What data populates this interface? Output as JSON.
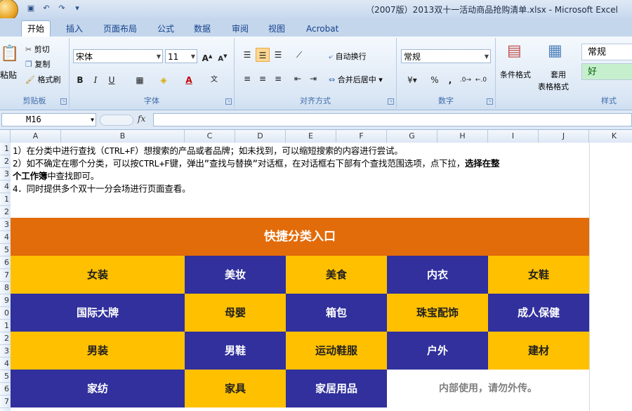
{
  "window": {
    "title": "（2007版）2013双十一活动商品抢购清单.xlsx - Microsoft Excel"
  },
  "ribbon": {
    "tabs": [
      "开始",
      "插入",
      "页面布局",
      "公式",
      "数据",
      "审阅",
      "视图",
      "Acrobat"
    ],
    "clipboard": {
      "paste": "粘贴",
      "cut": "剪切",
      "copy": "复制",
      "format_painter": "格式刷",
      "label": "剪贴板"
    },
    "font": {
      "name": "宋体",
      "size": "11",
      "label": "字体"
    },
    "alignment": {
      "wrap": "自动换行",
      "merge": "合并后居中",
      "label": "对齐方式"
    },
    "number": {
      "format": "常规",
      "label": "数字"
    },
    "styles": {
      "conditional": "条件格式",
      "table_format_line1": "套用",
      "table_format_line2": "表格格式",
      "normal": "常规",
      "good": "好",
      "label": "样式"
    }
  },
  "formula_bar": {
    "cell_ref": "M16",
    "fx": "fx",
    "value": ""
  },
  "columns": [
    "A",
    "B",
    "C",
    "D",
    "E",
    "F",
    "G",
    "H",
    "I",
    "J",
    "K"
  ],
  "rows": [
    "1",
    "2",
    "3",
    "4",
    "1",
    "2",
    "3",
    "4",
    "5",
    "6",
    "7",
    "8",
    "9",
    "0",
    "1",
    "2",
    "3",
    "4",
    "5",
    "6",
    "7"
  ],
  "notes": {
    "line1": "1）在分类中进行查找（CTRL+F）想搜索的产品或者品牌；如未找到，可以缩短搜索的内容进行尝试。",
    "line2_pre": "2）如不确定在哪个分类，可以按CTRL+F键，弹出”查找与替换”对话框，在对话框右下部有个查找范围选项，点下拉，",
    "line2_bold": "选择在整",
    "line3_bold": "个工作簿",
    "line3_post": "中查找即可。",
    "line4": "4．同时提供多个双十一分会场进行页面查看。"
  },
  "banner": "快捷分类入口",
  "categories": [
    [
      "女装",
      "美妆",
      "美食",
      "内衣",
      "女鞋"
    ],
    [
      "国际大牌",
      "母婴",
      "箱包",
      "珠宝配饰",
      "成人保健"
    ],
    [
      "男装",
      "男鞋",
      "运动鞋服",
      "户外",
      "建材"
    ],
    [
      "家纺",
      "家具",
      "家居用品"
    ]
  ],
  "footer_note": "内部使用，请勿外传。",
  "colors": {
    "orange": "#e26b0a",
    "yellow": "#ffc000",
    "navy": "#31309c"
  }
}
